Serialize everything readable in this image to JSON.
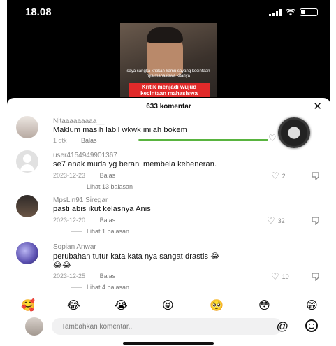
{
  "status_bar": {
    "time": "18.08"
  },
  "video": {
    "subtitle": "saya sangka kritikan kamu sayang kecintaan nya mahasiswa kitanya",
    "banner_line1": "Kritik menjadi wujud",
    "banner_line2": "kecintaan mahasiswa"
  },
  "comments_sheet": {
    "count_label": "633 komentar",
    "close_glyph": "✕",
    "comments": [
      {
        "username": "Nitaaaaaaaaa__",
        "text": "Maklum masih labil wkwk inilah bokem",
        "time": "1 dtk",
        "reply": "Balas",
        "likes": "",
        "replies_label": ""
      },
      {
        "username": "user4154949901367",
        "text": "se7 anak muda yg berani membela kebeneran.",
        "time": "2023-12-23",
        "reply": "Balas",
        "likes": "2",
        "replies_label": "Lihat 13 balasan"
      },
      {
        "username": "MpsLin91 Siregar",
        "text": "pasti abis ikut kelasnya Anis",
        "time": "2023-12-20",
        "reply": "Balas",
        "likes": "32",
        "replies_label": "Lihat 1 balasan"
      },
      {
        "username": "Sopian Anwar",
        "text": "perubahan tutur kata kata nya sangat drastis 😂",
        "text_line2": "😂😂",
        "time": "2023-12-25",
        "reply": "Balas",
        "likes": "10",
        "replies_label": "Lihat 4 balasan"
      }
    ],
    "emoji_bar": [
      "🥰",
      "😂",
      "😭",
      "😝",
      "🥺",
      "😳",
      "😁"
    ],
    "input": {
      "placeholder": "Tambahkan komentar..."
    },
    "mention_glyph": "@"
  },
  "colors": {
    "accent_green": "#59b43f",
    "banner_red": "#e12a2a"
  }
}
